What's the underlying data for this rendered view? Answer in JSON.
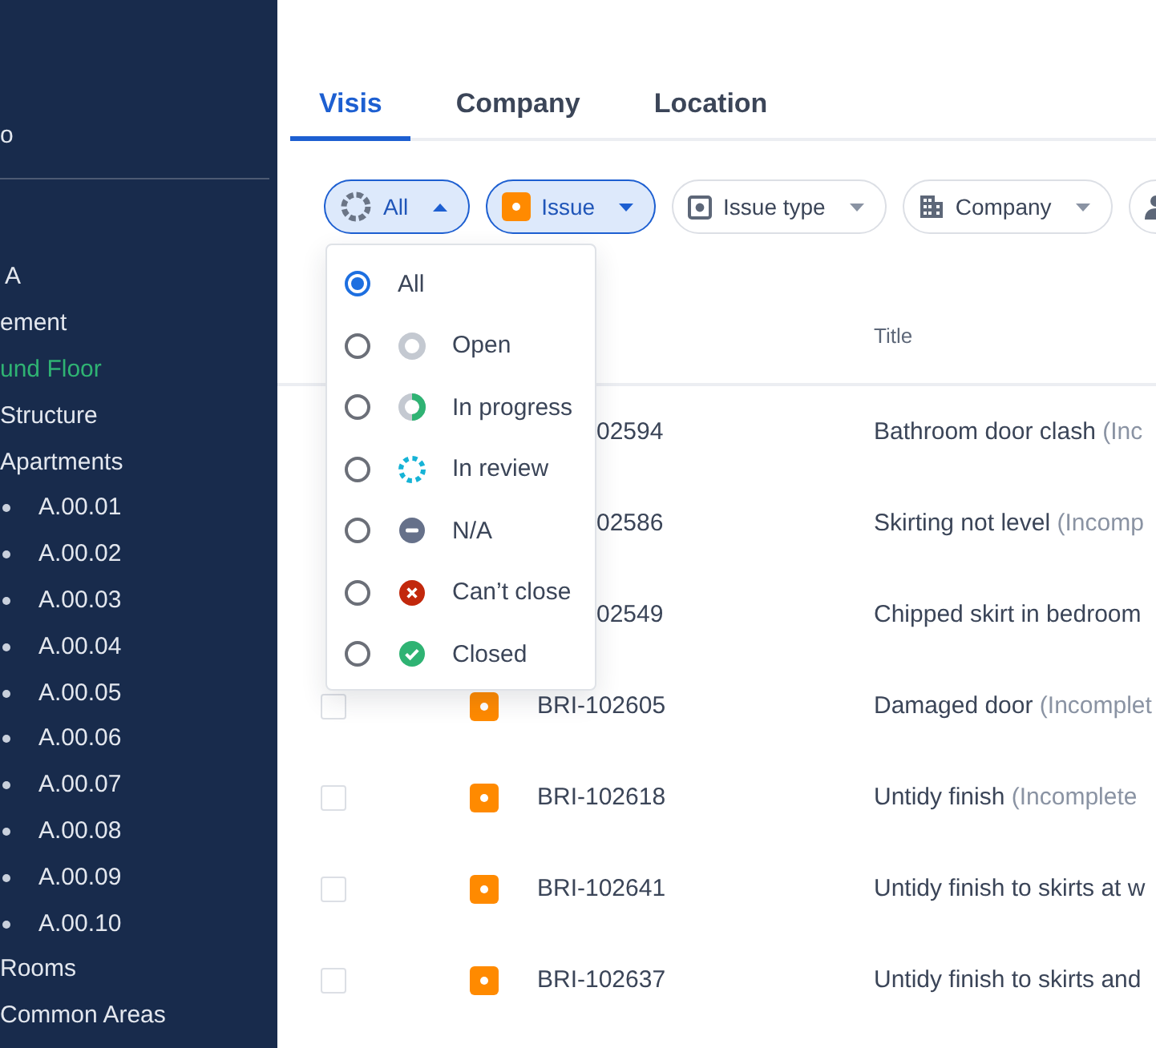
{
  "sidebar": {
    "top_item": "o",
    "items": [
      {
        "label": "A",
        "selected": false
      },
      {
        "label": "ement",
        "selected": false
      },
      {
        "label": "und Floor",
        "selected": true
      },
      {
        "label": "Structure",
        "selected": false
      },
      {
        "label": "Apartments",
        "selected": false,
        "children": [
          {
            "label": "A.00.01",
            "selected": false
          },
          {
            "label": "A.00.02",
            "selected": false
          },
          {
            "label": "A.00.03",
            "selected": false
          },
          {
            "label": "A.00.04",
            "selected": false
          },
          {
            "label": "A.00.05",
            "selected": false
          },
          {
            "label": "A.00.06",
            "selected": false
          },
          {
            "label": "A.00.07",
            "selected": false
          },
          {
            "label": "A.00.08",
            "selected": false
          },
          {
            "label": "A.00.09",
            "selected": false
          },
          {
            "label": "A.00.10",
            "selected": false
          }
        ]
      },
      {
        "label": "Rooms",
        "selected": false
      },
      {
        "label": "Common Areas",
        "selected": false
      }
    ]
  },
  "tabs": [
    {
      "label": "Visis",
      "selected": true
    },
    {
      "label": "Company",
      "selected": false
    },
    {
      "label": "Location",
      "selected": false
    }
  ],
  "filters": {
    "chips": [
      {
        "kind": "status",
        "label": "All",
        "selected": true,
        "expanded": true
      },
      {
        "kind": "issue",
        "label": "Issue",
        "selected": true,
        "expanded": false
      },
      {
        "kind": "issue-type",
        "label": "Issue type",
        "selected": false,
        "expanded": false
      },
      {
        "kind": "company",
        "label": "Company",
        "selected": false,
        "expanded": false
      },
      {
        "kind": "person",
        "selected": false
      }
    ],
    "menu": {
      "items": [
        {
          "label": "All",
          "selected": true
        },
        {
          "kind": "open",
          "label": "Open",
          "selected": false
        },
        {
          "kind": "progress",
          "label": "In progress",
          "selected": false
        },
        {
          "kind": "review",
          "label": "In review",
          "selected": false
        },
        {
          "kind": "na",
          "label": "N/A",
          "selected": false
        },
        {
          "kind": "cant",
          "label": "Can’t close",
          "selected": false
        },
        {
          "kind": "closed",
          "label": "Closed",
          "selected": false
        }
      ]
    }
  },
  "table": {
    "columns": [
      {
        "label": "Title"
      }
    ],
    "rows": [
      {
        "covered": true,
        "id": "02594",
        "title": "Bathroom door clash",
        "note": "(Inc"
      },
      {
        "covered": true,
        "id": "02586",
        "title": "Skirting not level",
        "note": "(Incomp"
      },
      {
        "covered": true,
        "id": "02549",
        "title": "Chipped skirt in bedroom"
      },
      {
        "kind": "issue",
        "checked": false,
        "id": "BRI-102605",
        "title": "Damaged door",
        "note": "(Incomplet"
      },
      {
        "kind": "issue",
        "checked": false,
        "id": "BRI-102618",
        "title": "Untidy finish",
        "note": "(Incomplete"
      },
      {
        "kind": "issue",
        "checked": false,
        "id": "BRI-102641",
        "title": "Untidy finish to skirts at w"
      },
      {
        "kind": "issue",
        "checked": false,
        "id": "BRI-102637",
        "title": "Untidy finish to skirts and"
      }
    ]
  }
}
